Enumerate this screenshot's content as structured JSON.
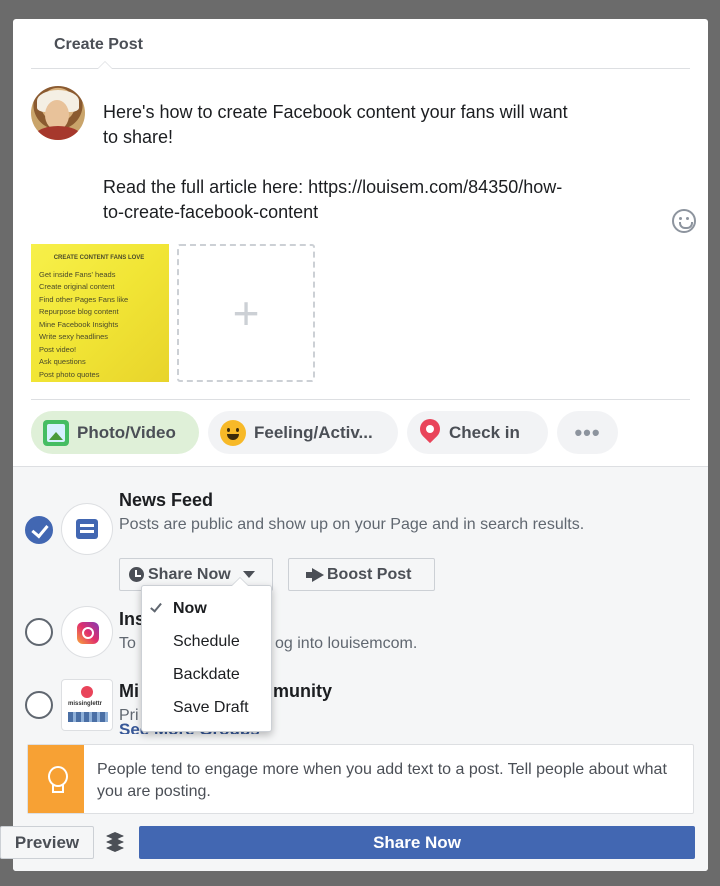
{
  "dialog": {
    "title": "Create Post"
  },
  "composer": {
    "text": "Here's how to create Facebook content your fans will want\nto share!\n\nRead the full article here: https://louisem.com/84350/how-\nto-create-facebook-content",
    "thumbnail_lines": [
      "CREATE CONTENT FANS LOVE",
      "Get inside Fans' heads",
      "Create original content",
      "Find other Pages Fans like",
      "Repurpose blog content",
      "Mine Facebook Insights",
      "Write sexy headlines",
      "Post video!",
      "Ask questions",
      "Post photo quotes"
    ],
    "add_photo_glyph": "+"
  },
  "actions": {
    "photo_video": "Photo/Video",
    "feeling": "Feeling/Activ...",
    "check_in": "Check in",
    "more": "•••"
  },
  "destinations": [
    {
      "title": "News Feed",
      "subtitle": "Posts are public and show up on your Page and in search results.",
      "checked": true
    },
    {
      "title": "Ins",
      "subtitle": "To",
      "subtitle_tail": "og into louisemcom.",
      "checked": false
    },
    {
      "title": "Mi",
      "title_tail": "munity",
      "subtitle": "Pri",
      "checked": false
    }
  ],
  "schedule": {
    "share_now_label": "Share Now",
    "boost_label": "Boost Post"
  },
  "menu": {
    "items": [
      {
        "label": "Now",
        "selected": true
      },
      {
        "label": "Schedule",
        "selected": false
      },
      {
        "label": "Backdate",
        "selected": false
      },
      {
        "label": "Save Draft",
        "selected": false
      }
    ]
  },
  "see_more": "See More Groups",
  "tip": {
    "text": "People tend to engage more when you add text to a post. Tell people about what you are posting."
  },
  "footer": {
    "preview_label": "Preview",
    "share_label": "Share Now"
  },
  "colors": {
    "primary": "#4267b2",
    "tip_accent": "#f7a134",
    "photo_chip": "#dff0d8"
  }
}
